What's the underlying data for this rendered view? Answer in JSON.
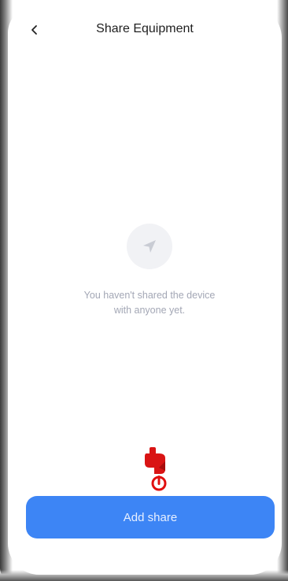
{
  "header": {
    "title": "Share Equipment",
    "back_icon": "chevron-left-icon"
  },
  "empty_state": {
    "icon": "send-arrow-icon",
    "message_line1": "You haven't shared the device",
    "message_line2": "with anyone yet."
  },
  "footer": {
    "add_share_label": "Add share",
    "overlay_icon": "pointing-hand-icon"
  },
  "colors": {
    "primary": "#3d85f5",
    "muted_text": "#a3a7b5",
    "pointer": "#e01010"
  }
}
